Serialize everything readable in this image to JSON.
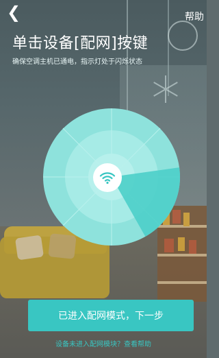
{
  "nav": {
    "back_icon": "chevron-left-icon",
    "help_label": "帮助"
  },
  "header": {
    "title": "单击设备[配网]按键",
    "subtitle": "确保空调主机已通电，指示灯处于闪烁状态"
  },
  "dial": {
    "progress_fraction": 0.19,
    "center_icon": "wifi-icon",
    "colors": {
      "base": "#8ee2dc",
      "light": "#a8ebe6",
      "dark": "#4ccfc9"
    }
  },
  "actions": {
    "primary_button_label": "已进入配网模式，下一步",
    "help_link_text": "设备未进入配网模块？查看帮助"
  }
}
